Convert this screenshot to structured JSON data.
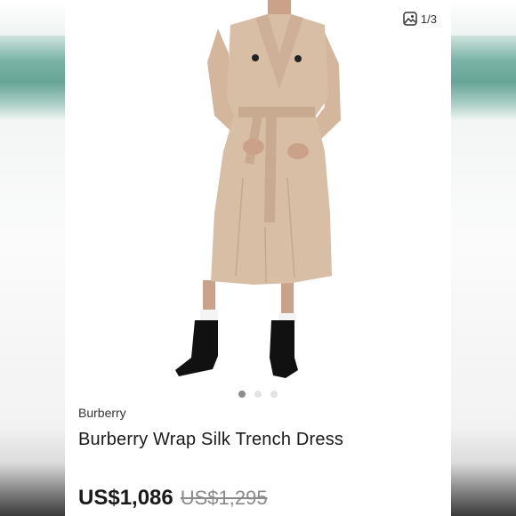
{
  "gallery": {
    "counter": "1/3",
    "dots": [
      {
        "active": true
      },
      {
        "active": false
      },
      {
        "active": false
      }
    ]
  },
  "listing": {
    "brand": "Burberry",
    "title": "Burberry Wrap Silk Trench Dress",
    "price_current": "US$1,086",
    "price_original": "US$1,295"
  },
  "icons": {
    "counter_icon": "gallery-icon"
  },
  "colors": {
    "dress": "#d9bea6",
    "backdrop_teal": "#67a597",
    "text_dark": "#1a1a1a",
    "text_muted": "#8a8a8a"
  }
}
